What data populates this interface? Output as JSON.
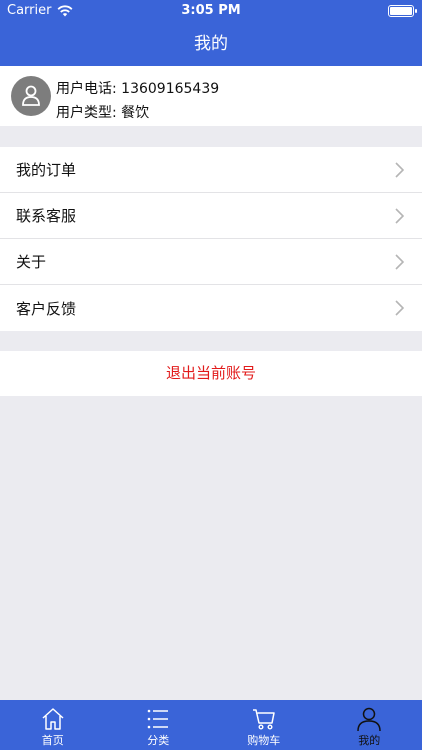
{
  "status_bar": {
    "carrier": "Carrier",
    "time": "3:05 PM"
  },
  "nav": {
    "title": "我的"
  },
  "profile": {
    "phone_text": "用户电话: 13609165439",
    "type_text": "用户类型: 餐饮"
  },
  "menu": {
    "items": [
      {
        "label": "我的订单"
      },
      {
        "label": "联系客服"
      },
      {
        "label": "关于"
      },
      {
        "label": "客户反馈"
      }
    ]
  },
  "logout": {
    "label": "退出当前账号",
    "color": "#e21b1b"
  },
  "tabbar": {
    "tabs": [
      {
        "label": "首页",
        "icon": "home-icon"
      },
      {
        "label": "分类",
        "icon": "list-icon"
      },
      {
        "label": "购物车",
        "icon": "cart-icon"
      },
      {
        "label": "我的",
        "icon": "user-icon",
        "active": true
      }
    ]
  },
  "colors": {
    "accent": "#3a64d8",
    "background": "#ebebf0"
  }
}
